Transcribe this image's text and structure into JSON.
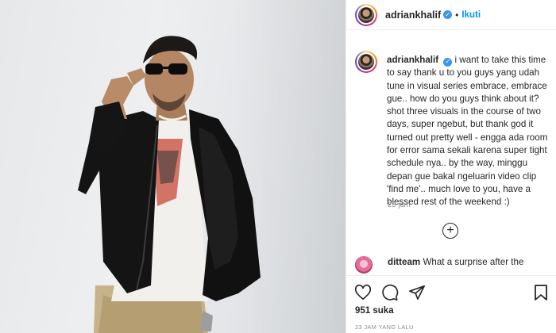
{
  "post": {
    "image_alt": "man in black bomber jacket and sunglasses"
  },
  "header": {
    "username": "adriankhalif",
    "separator": "•",
    "follow_label": "Ikuti"
  },
  "caption": {
    "username": "adriankhalif",
    "text": "i want to take this time to say thank u to you guys yang udah tune in visual series embrace, embrace gue.. how do you guys think about it? shot three visuals in the course of two days, super ngebut, but thank god it turned out pretty well - engga ada room for error sama sekali karena super tight schedule nya.. by the way, minggu depan gue bakal ngeluarin video clip 'find me'.. much love to you, have a blessed rest of the weekend :)",
    "time": "23 jam"
  },
  "load_more": {
    "icon": "plus-circle-icon",
    "symbol": "+"
  },
  "comments": [
    {
      "username": "ditteam",
      "text": "What a surprise after the"
    }
  ],
  "actions": {
    "likes": "951 suka",
    "posted_ago": "23 JAM YANG LALU"
  },
  "colors": {
    "accent": "#0095f6",
    "verified": "#3897f0",
    "text": "#262626",
    "muted": "#8e8e8e",
    "border": "#efefef"
  }
}
